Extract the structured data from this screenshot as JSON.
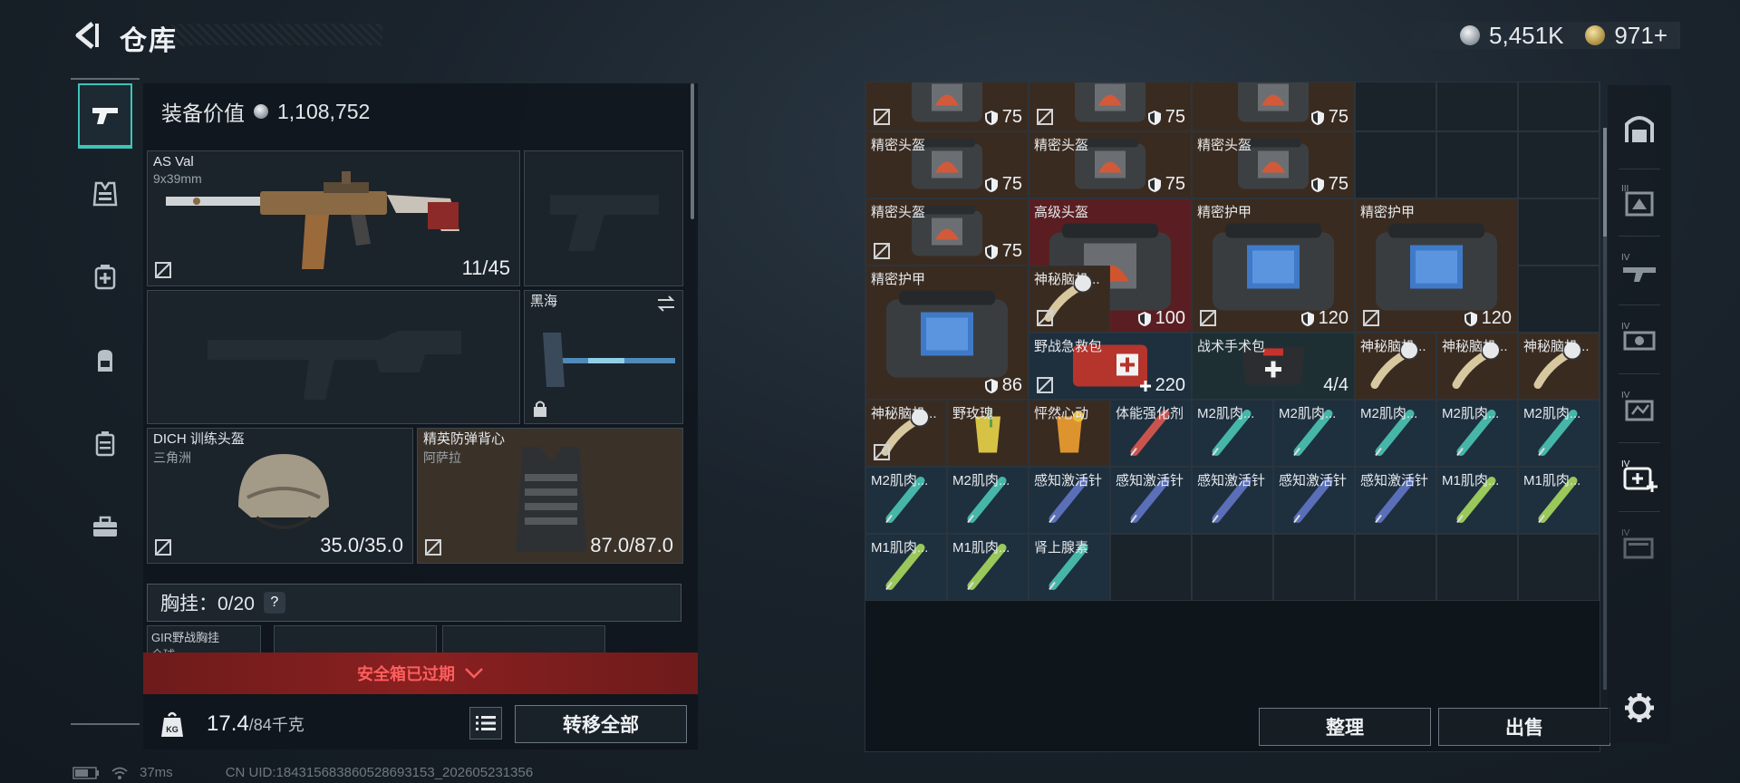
{
  "header": {
    "title": "仓库",
    "currency": {
      "silver": "5,451K",
      "gold": "971",
      "gold_plus": "+"
    }
  },
  "colors": {
    "accent_teal": "#3ec3b7",
    "danger_red": "#ff5e5e",
    "panel_dark": "#10161c"
  },
  "loadout": {
    "equip_value_label": "装备价值",
    "equip_value": "1,108,752",
    "primary_weapon": {
      "name": "AS Val",
      "ammo_type": "9x39mm",
      "ammo": "11/45"
    },
    "melee": {
      "name": "黑海"
    },
    "helmet": {
      "name": "DICH 训练头盔",
      "sub": "三角洲",
      "durability": "35.0/35.0"
    },
    "armor": {
      "name": "精英防弹背心",
      "sub": "阿萨拉",
      "durability": "87.0/87.0"
    },
    "chest_rig": {
      "label": "胸挂：",
      "value": "0/20",
      "help": "?"
    },
    "chest_rig_item": {
      "name": "GIR野战胸挂",
      "sub": "全球"
    },
    "safe_box": {
      "label": "安全箱已过期"
    },
    "weight": {
      "current": "17.4",
      "max": "/84千克"
    },
    "transfer_all": "转移全部"
  },
  "storage": {
    "sort_label": "整理",
    "sell_label": "出售",
    "items": [
      {
        "name": "",
        "val": "75",
        "kind": "helmet",
        "row": 0,
        "col": 0,
        "w": 2,
        "h": 1,
        "bg": "brown",
        "locked": true,
        "top_clip": true
      },
      {
        "name": "",
        "val": "75",
        "kind": "helmet",
        "row": 0,
        "col": 2,
        "w": 2,
        "h": 1,
        "bg": "brown",
        "locked": true,
        "top_clip": true
      },
      {
        "name": "",
        "val": "75",
        "kind": "helmet",
        "row": 0,
        "col": 4,
        "w": 2,
        "h": 1,
        "bg": "brown",
        "locked": false,
        "top_clip": true
      },
      {
        "name": "精密头盔",
        "val": "75",
        "kind": "helmet",
        "row": 1,
        "col": 0,
        "w": 2,
        "h": 1,
        "bg": "brown",
        "locked": false
      },
      {
        "name": "精密头盔",
        "val": "75",
        "kind": "helmet",
        "row": 1,
        "col": 2,
        "w": 2,
        "h": 1,
        "bg": "brown",
        "locked": false
      },
      {
        "name": "精密头盔",
        "val": "75",
        "kind": "helmet",
        "row": 1,
        "col": 4,
        "w": 2,
        "h": 1,
        "bg": "brown",
        "locked": false
      },
      {
        "name": "精密头盔",
        "val": "75",
        "kind": "helmet",
        "row": 2,
        "col": 0,
        "w": 2,
        "h": 1,
        "bg": "brown",
        "locked": true
      },
      {
        "name": "高级头盔",
        "val": "100",
        "kind": "bighelmet",
        "row": 2,
        "col": 2,
        "w": 2,
        "h": 2,
        "bg": "red",
        "locked": true
      },
      {
        "name": "精密护甲",
        "val": "120",
        "kind": "armor",
        "row": 2,
        "col": 4,
        "w": 2,
        "h": 2,
        "bg": "brown",
        "locked": true
      },
      {
        "name": "精密护甲",
        "val": "120",
        "kind": "armor",
        "row": 2,
        "col": 6,
        "w": 2,
        "h": 2,
        "bg": "brown",
        "locked": true
      },
      {
        "name": "精密护甲",
        "val": "86",
        "kind": "armor",
        "row": 3,
        "col": 0,
        "w": 2,
        "h": 2,
        "bg": "brown",
        "locked": false
      },
      {
        "name": "神秘脑机...",
        "val": "",
        "kind": "implant",
        "row": 3,
        "col": 2,
        "w": 1,
        "h": 1,
        "bg": "brown",
        "locked": true
      },
      {
        "name": "野战急救包",
        "val": "220",
        "kind": "medkit",
        "row": 4,
        "col": 2,
        "w": 2,
        "h": 1,
        "bg": "blue",
        "locked": true,
        "heal": true
      },
      {
        "name": "战术手术包",
        "val": "4/4",
        "kind": "surgkit",
        "row": 4,
        "col": 4,
        "w": 2,
        "h": 1,
        "bg": "teal",
        "locked": false
      },
      {
        "name": "神秘脑机...",
        "val": "",
        "kind": "implant",
        "row": 4,
        "col": 6,
        "w": 1,
        "h": 1,
        "bg": "brown",
        "locked": false
      },
      {
        "name": "神秘脑机...",
        "val": "",
        "kind": "implant",
        "row": 4,
        "col": 7,
        "w": 1,
        "h": 1,
        "bg": "brown",
        "locked": false
      },
      {
        "name": "神秘脑机...",
        "val": "",
        "kind": "implant",
        "row": 4,
        "col": 8,
        "w": 1,
        "h": 1,
        "bg": "brown",
        "locked": false
      },
      {
        "name": "神秘脑机...",
        "val": "",
        "kind": "implant",
        "row": 5,
        "col": 0,
        "w": 1,
        "h": 1,
        "bg": "brown",
        "locked": true
      },
      {
        "name": "野玫瑰",
        "val": "",
        "kind": "drink",
        "row": 5,
        "col": 1,
        "w": 1,
        "h": 1,
        "bg": "brown",
        "locked": false
      },
      {
        "name": "怦然心动",
        "val": "",
        "kind": "drink2",
        "row": 5,
        "col": 2,
        "w": 1,
        "h": 1,
        "bg": "brown",
        "locked": false
      },
      {
        "name": "体能强化剂",
        "val": "",
        "kind": "inj_red",
        "row": 5,
        "col": 3,
        "w": 1,
        "h": 1,
        "bg": "blue",
        "locked": false
      },
      {
        "name": "M2肌肉...",
        "val": "",
        "kind": "inj_teal",
        "row": 5,
        "col": 4,
        "w": 1,
        "h": 1,
        "bg": "blue",
        "locked": false
      },
      {
        "name": "M2肌肉...",
        "val": "",
        "kind": "inj_teal",
        "row": 5,
        "col": 5,
        "w": 1,
        "h": 1,
        "bg": "blue",
        "locked": false
      },
      {
        "name": "M2肌肉...",
        "val": "",
        "kind": "inj_teal",
        "row": 5,
        "col": 6,
        "w": 1,
        "h": 1,
        "bg": "blue",
        "locked": false
      },
      {
        "name": "M2肌肉...",
        "val": "",
        "kind": "inj_teal",
        "row": 5,
        "col": 7,
        "w": 1,
        "h": 1,
        "bg": "blue",
        "locked": false
      },
      {
        "name": "M2肌肉...",
        "val": "",
        "kind": "inj_teal",
        "row": 5,
        "col": 8,
        "w": 1,
        "h": 1,
        "bg": "blue",
        "locked": false
      },
      {
        "name": "M2肌肉...",
        "val": "",
        "kind": "inj_teal",
        "row": 6,
        "col": 0,
        "w": 1,
        "h": 1,
        "bg": "blue",
        "locked": false
      },
      {
        "name": "M2肌肉...",
        "val": "",
        "kind": "inj_teal",
        "row": 6,
        "col": 1,
        "w": 1,
        "h": 1,
        "bg": "blue",
        "locked": false
      },
      {
        "name": "感知激活针",
        "val": "",
        "kind": "inj_blue",
        "row": 6,
        "col": 2,
        "w": 1,
        "h": 1,
        "bg": "blue",
        "locked": false
      },
      {
        "name": "感知激活针",
        "val": "",
        "kind": "inj_blue",
        "row": 6,
        "col": 3,
        "w": 1,
        "h": 1,
        "bg": "blue",
        "locked": false
      },
      {
        "name": "感知激活针",
        "val": "",
        "kind": "inj_blue",
        "row": 6,
        "col": 4,
        "w": 1,
        "h": 1,
        "bg": "blue",
        "locked": false
      },
      {
        "name": "感知激活针",
        "val": "",
        "kind": "inj_blue",
        "row": 6,
        "col": 5,
        "w": 1,
        "h": 1,
        "bg": "blue",
        "locked": false
      },
      {
        "name": "感知激活针",
        "val": "",
        "kind": "inj_blue",
        "row": 6,
        "col": 6,
        "w": 1,
        "h": 1,
        "bg": "blue",
        "locked": false
      },
      {
        "name": "M1肌肉...",
        "val": "",
        "kind": "inj_green",
        "row": 6,
        "col": 7,
        "w": 1,
        "h": 1,
        "bg": "blue",
        "locked": false
      },
      {
        "name": "M1肌肉...",
        "val": "",
        "kind": "inj_green",
        "row": 6,
        "col": 8,
        "w": 1,
        "h": 1,
        "bg": "blue",
        "locked": false
      },
      {
        "name": "M1肌肉...",
        "val": "",
        "kind": "inj_green",
        "row": 7,
        "col": 0,
        "w": 1,
        "h": 1,
        "bg": "blue",
        "locked": false
      },
      {
        "name": "M1肌肉...",
        "val": "",
        "kind": "inj_green",
        "row": 7,
        "col": 1,
        "w": 1,
        "h": 1,
        "bg": "blue",
        "locked": false
      },
      {
        "name": "肾上腺素",
        "val": "",
        "kind": "inj_teal",
        "row": 7,
        "col": 2,
        "w": 1,
        "h": 1,
        "bg": "blue",
        "locked": false
      }
    ]
  },
  "category_rail": {
    "items": [
      {
        "icon": "storage-arch-icon",
        "label": ""
      },
      {
        "icon": "tier-iii-crate-icon",
        "label": "III"
      },
      {
        "icon": "tier-iv-gun-icon",
        "label": "IV"
      },
      {
        "icon": "tier-iv-scope-icon",
        "label": "IV"
      },
      {
        "icon": "tier-iv-case-icon",
        "label": "IV"
      },
      {
        "icon": "tier-iv-medical-icon",
        "label": "IV"
      },
      {
        "icon": "tier-iv-folder-icon",
        "label": "IV"
      },
      {
        "icon": "settings-gear-icon",
        "label": ""
      }
    ]
  },
  "status": {
    "ping": "37ms",
    "uid": "CN UID:18431568386052869315​3_202605231356"
  }
}
